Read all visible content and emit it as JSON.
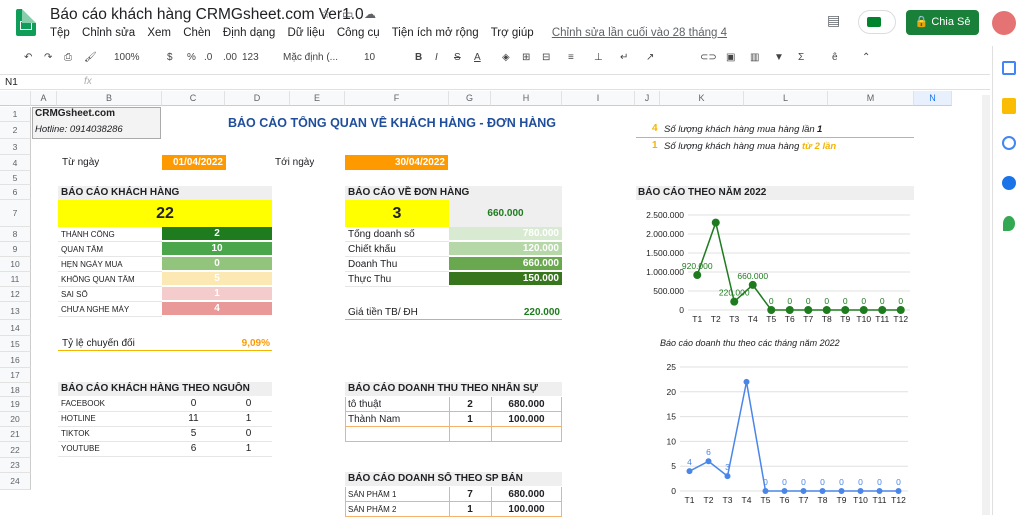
{
  "doc": {
    "title": "Báo cáo khách hàng CRMGsheet.com Ver1.0",
    "last_edit": "Chỉnh sửa lần cuối vào 28 tháng 4",
    "share": "Chia Sẻ"
  },
  "menus": [
    "Tệp",
    "Chỉnh sửa",
    "Xem",
    "Chèn",
    "Định dạng",
    "Dữ liệu",
    "Công cụ",
    "Tiện ích mở rộng",
    "Trợ giúp"
  ],
  "toolbar": {
    "zoom": "100%",
    "currency": "$",
    "percent": "%",
    "dec0": ".0",
    "dec00": ".00",
    "fmt": "123",
    "font": "Mặc định (...",
    "size": "10"
  },
  "formula_bar": {
    "cell_ref": "N1",
    "fx": "fx"
  },
  "columns": [
    "A",
    "B",
    "C",
    "D",
    "E",
    "F",
    "G",
    "H",
    "I",
    "J",
    "K",
    "L",
    "M",
    "N"
  ],
  "rows": [
    "1",
    "2",
    "3",
    "4",
    "5",
    "6",
    "7",
    "8",
    "9",
    "10",
    "11",
    "12",
    "13",
    "14",
    "15",
    "16",
    "17",
    "18",
    "19",
    "20",
    "21",
    "22",
    "23",
    "24"
  ],
  "sheet": {
    "brand": "CRMGsheet.com",
    "hotline": "Hotline: 0914038286",
    "main_title": "BÁO CÁO TỔNG QUAN VỀ KHÁCH HÀNG - ĐƠN HÀNG",
    "from_label": "Từ ngày",
    "from_date": "01/04/2022",
    "to_label": "Tới ngày",
    "to_date": "30/04/2022",
    "note1_num": "4",
    "note1_text": "Số lượng khách hàng mua hàng lần",
    "note1_bold": "1",
    "note2_num": "1",
    "note2_text": "Số lượng khách hàng mua hàng",
    "note2_bold": "từ 2 lần",
    "customers": {
      "header": "BÁO CÁO KHÁCH HÀNG",
      "total": "22",
      "rows": [
        {
          "label": "THÀNH CÔNG",
          "value": "2",
          "color": "#1e7b1e"
        },
        {
          "label": "QUAN TÂM",
          "value": "10",
          "color": "#4ba64b"
        },
        {
          "label": "HẸN NGÀY MUA",
          "value": "0",
          "color": "#93c47d"
        },
        {
          "label": "KHÔNG QUAN TÂM",
          "value": "5",
          "color": "#fce8b2"
        },
        {
          "label": "SAI SỐ",
          "value": "1",
          "color": "#f4cccc"
        },
        {
          "label": "CHƯA NGHE MÁY",
          "value": "4",
          "color": "#ea9999"
        }
      ],
      "conversion_label": "Tỷ lệ chuyển đổi",
      "conversion_value": "9,09%"
    },
    "orders": {
      "header": "BÁO CÁO VỀ ĐƠN HÀNG",
      "count": "3",
      "amount": "660.000",
      "rows": [
        {
          "label": "Tổng doanh số",
          "value": "780.000",
          "color": "#d9ead3"
        },
        {
          "label": "Chiết khấu",
          "value": "120.000",
          "color": "#b6d7a8"
        },
        {
          "label": "Doanh Thu",
          "value": "660.000",
          "color": "#6aa84f"
        },
        {
          "label": "Thực Thu",
          "value": "150.000",
          "color": "#38761d"
        }
      ],
      "avg_label": "Giá tiền TB/ ĐH",
      "avg_value": "220.000"
    },
    "sources": {
      "header": "BÁO CÁO KHÁCH HÀNG THEO NGUỒN",
      "rows": [
        {
          "label": "FACEBOOK",
          "a": "0",
          "b": "0"
        },
        {
          "label": "HOTLINE",
          "a": "11",
          "b": "1"
        },
        {
          "label": "TIKTOK",
          "a": "5",
          "b": "0"
        },
        {
          "label": "YOUTUBE",
          "a": "6",
          "b": "1"
        }
      ]
    },
    "staff": {
      "header": "BÁO CÁO DOANH THU THEO NHÂN SỰ",
      "rows": [
        {
          "name": "tô thuật",
          "count": "2",
          "value": "680.000"
        },
        {
          "name": "Thành Nam",
          "count": "1",
          "value": "100.000"
        }
      ]
    },
    "products": {
      "header": "BÁO CÁO DOANH SỐ THEO SP BÁN",
      "rows": [
        {
          "name": "SẢN PHẨM 1",
          "count": "7",
          "value": "680.000"
        },
        {
          "name": "SẢN PHẨM 2",
          "count": "1",
          "value": "100.000"
        }
      ]
    },
    "year_header": "BÁO CÁO THEO NĂM 2022"
  },
  "chart_data": [
    {
      "type": "line",
      "title": "",
      "x": [
        "T1",
        "T2",
        "T3",
        "T4",
        "T5",
        "T6",
        "T7",
        "T8",
        "T9",
        "T10",
        "T11",
        "T12"
      ],
      "series": [
        {
          "values": [
            920000,
            2300000,
            220000,
            660000,
            0,
            0,
            0,
            0,
            0,
            0,
            0,
            0
          ]
        }
      ],
      "data_labels": [
        "920.000",
        "",
        "220.000",
        "660.000",
        "0",
        "0",
        "0",
        "0",
        "0",
        "0",
        "0",
        "0"
      ],
      "yticks": [
        "2.500.000",
        "2.000.000",
        "1.500.000",
        "1.000.000",
        "500.000",
        "0"
      ],
      "ylim": [
        0,
        2500000
      ],
      "color": "#1e7b1e"
    },
    {
      "type": "line",
      "title": "Báo cáo doanh thu theo các tháng năm 2022",
      "x": [
        "T1",
        "T2",
        "T3",
        "T4",
        "T5",
        "T6",
        "T7",
        "T8",
        "T9",
        "T10",
        "T11",
        "T12"
      ],
      "series": [
        {
          "values": [
            4,
            6,
            3,
            22,
            0,
            0,
            0,
            0,
            0,
            0,
            0,
            0
          ]
        }
      ],
      "data_labels": [
        "4",
        "6",
        "3",
        "",
        "0",
        "0",
        "0",
        "0",
        "0",
        "0",
        "0",
        "0"
      ],
      "yticks": [
        "25",
        "20",
        "15",
        "10",
        "5",
        "0"
      ],
      "ylim": [
        0,
        25
      ],
      "color": "#4a86e8"
    }
  ]
}
